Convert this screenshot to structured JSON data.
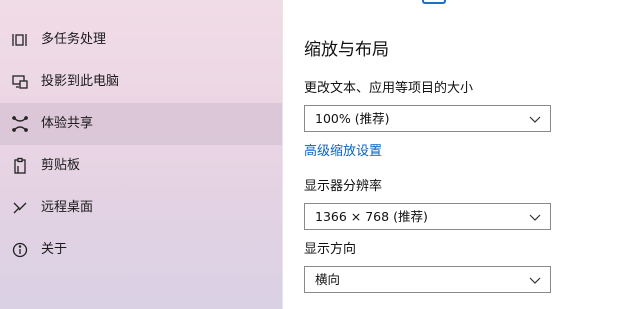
{
  "sidebar": {
    "items": [
      {
        "label": "多任务处理",
        "icon": "multitasking-icon",
        "selected": false
      },
      {
        "label": "投影到此电脑",
        "icon": "projecting-icon",
        "selected": false
      },
      {
        "label": "体验共享",
        "icon": "shared-experiences-icon",
        "selected": true
      },
      {
        "label": "剪贴板",
        "icon": "clipboard-icon",
        "selected": false
      },
      {
        "label": "远程桌面",
        "icon": "remote-desktop-icon",
        "selected": false
      },
      {
        "label": "关于",
        "icon": "info-icon",
        "selected": false
      }
    ]
  },
  "main": {
    "section_title": "缩放与布局",
    "scale": {
      "label": "更改文本、应用等项目的大小",
      "value": "100% (推荐)"
    },
    "advanced_scaling_link": "高级缩放设置",
    "resolution": {
      "label": "显示器分辨率",
      "value": "1366 × 768 (推荐)"
    },
    "orientation": {
      "label": "显示方向",
      "value": "横向"
    }
  },
  "colors": {
    "accent": "#0a63c2",
    "sidebar_bg": "#ecd6e4",
    "selected_bg": "#d8c6d8"
  }
}
